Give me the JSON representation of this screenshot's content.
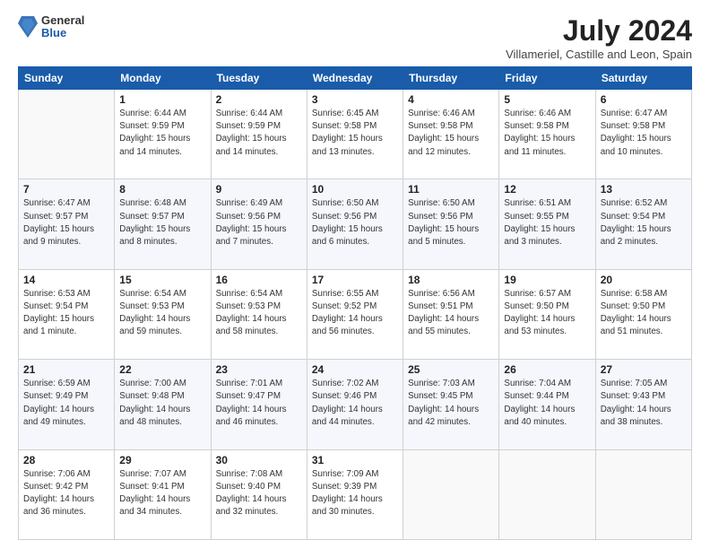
{
  "header": {
    "logo_general": "General",
    "logo_blue": "Blue",
    "month_title": "July 2024",
    "location": "Villameriel, Castille and Leon, Spain"
  },
  "weekdays": [
    "Sunday",
    "Monday",
    "Tuesday",
    "Wednesday",
    "Thursday",
    "Friday",
    "Saturday"
  ],
  "weeks": [
    [
      {
        "day": "",
        "info": ""
      },
      {
        "day": "1",
        "info": "Sunrise: 6:44 AM\nSunset: 9:59 PM\nDaylight: 15 hours\nand 14 minutes."
      },
      {
        "day": "2",
        "info": "Sunrise: 6:44 AM\nSunset: 9:59 PM\nDaylight: 15 hours\nand 14 minutes."
      },
      {
        "day": "3",
        "info": "Sunrise: 6:45 AM\nSunset: 9:58 PM\nDaylight: 15 hours\nand 13 minutes."
      },
      {
        "day": "4",
        "info": "Sunrise: 6:46 AM\nSunset: 9:58 PM\nDaylight: 15 hours\nand 12 minutes."
      },
      {
        "day": "5",
        "info": "Sunrise: 6:46 AM\nSunset: 9:58 PM\nDaylight: 15 hours\nand 11 minutes."
      },
      {
        "day": "6",
        "info": "Sunrise: 6:47 AM\nSunset: 9:58 PM\nDaylight: 15 hours\nand 10 minutes."
      }
    ],
    [
      {
        "day": "7",
        "info": "Sunrise: 6:47 AM\nSunset: 9:57 PM\nDaylight: 15 hours\nand 9 minutes."
      },
      {
        "day": "8",
        "info": "Sunrise: 6:48 AM\nSunset: 9:57 PM\nDaylight: 15 hours\nand 8 minutes."
      },
      {
        "day": "9",
        "info": "Sunrise: 6:49 AM\nSunset: 9:56 PM\nDaylight: 15 hours\nand 7 minutes."
      },
      {
        "day": "10",
        "info": "Sunrise: 6:50 AM\nSunset: 9:56 PM\nDaylight: 15 hours\nand 6 minutes."
      },
      {
        "day": "11",
        "info": "Sunrise: 6:50 AM\nSunset: 9:56 PM\nDaylight: 15 hours\nand 5 minutes."
      },
      {
        "day": "12",
        "info": "Sunrise: 6:51 AM\nSunset: 9:55 PM\nDaylight: 15 hours\nand 3 minutes."
      },
      {
        "day": "13",
        "info": "Sunrise: 6:52 AM\nSunset: 9:54 PM\nDaylight: 15 hours\nand 2 minutes."
      }
    ],
    [
      {
        "day": "14",
        "info": "Sunrise: 6:53 AM\nSunset: 9:54 PM\nDaylight: 15 hours\nand 1 minute."
      },
      {
        "day": "15",
        "info": "Sunrise: 6:54 AM\nSunset: 9:53 PM\nDaylight: 14 hours\nand 59 minutes."
      },
      {
        "day": "16",
        "info": "Sunrise: 6:54 AM\nSunset: 9:53 PM\nDaylight: 14 hours\nand 58 minutes."
      },
      {
        "day": "17",
        "info": "Sunrise: 6:55 AM\nSunset: 9:52 PM\nDaylight: 14 hours\nand 56 minutes."
      },
      {
        "day": "18",
        "info": "Sunrise: 6:56 AM\nSunset: 9:51 PM\nDaylight: 14 hours\nand 55 minutes."
      },
      {
        "day": "19",
        "info": "Sunrise: 6:57 AM\nSunset: 9:50 PM\nDaylight: 14 hours\nand 53 minutes."
      },
      {
        "day": "20",
        "info": "Sunrise: 6:58 AM\nSunset: 9:50 PM\nDaylight: 14 hours\nand 51 minutes."
      }
    ],
    [
      {
        "day": "21",
        "info": "Sunrise: 6:59 AM\nSunset: 9:49 PM\nDaylight: 14 hours\nand 49 minutes."
      },
      {
        "day": "22",
        "info": "Sunrise: 7:00 AM\nSunset: 9:48 PM\nDaylight: 14 hours\nand 48 minutes."
      },
      {
        "day": "23",
        "info": "Sunrise: 7:01 AM\nSunset: 9:47 PM\nDaylight: 14 hours\nand 46 minutes."
      },
      {
        "day": "24",
        "info": "Sunrise: 7:02 AM\nSunset: 9:46 PM\nDaylight: 14 hours\nand 44 minutes."
      },
      {
        "day": "25",
        "info": "Sunrise: 7:03 AM\nSunset: 9:45 PM\nDaylight: 14 hours\nand 42 minutes."
      },
      {
        "day": "26",
        "info": "Sunrise: 7:04 AM\nSunset: 9:44 PM\nDaylight: 14 hours\nand 40 minutes."
      },
      {
        "day": "27",
        "info": "Sunrise: 7:05 AM\nSunset: 9:43 PM\nDaylight: 14 hours\nand 38 minutes."
      }
    ],
    [
      {
        "day": "28",
        "info": "Sunrise: 7:06 AM\nSunset: 9:42 PM\nDaylight: 14 hours\nand 36 minutes."
      },
      {
        "day": "29",
        "info": "Sunrise: 7:07 AM\nSunset: 9:41 PM\nDaylight: 14 hours\nand 34 minutes."
      },
      {
        "day": "30",
        "info": "Sunrise: 7:08 AM\nSunset: 9:40 PM\nDaylight: 14 hours\nand 32 minutes."
      },
      {
        "day": "31",
        "info": "Sunrise: 7:09 AM\nSunset: 9:39 PM\nDaylight: 14 hours\nand 30 minutes."
      },
      {
        "day": "",
        "info": ""
      },
      {
        "day": "",
        "info": ""
      },
      {
        "day": "",
        "info": ""
      }
    ]
  ]
}
